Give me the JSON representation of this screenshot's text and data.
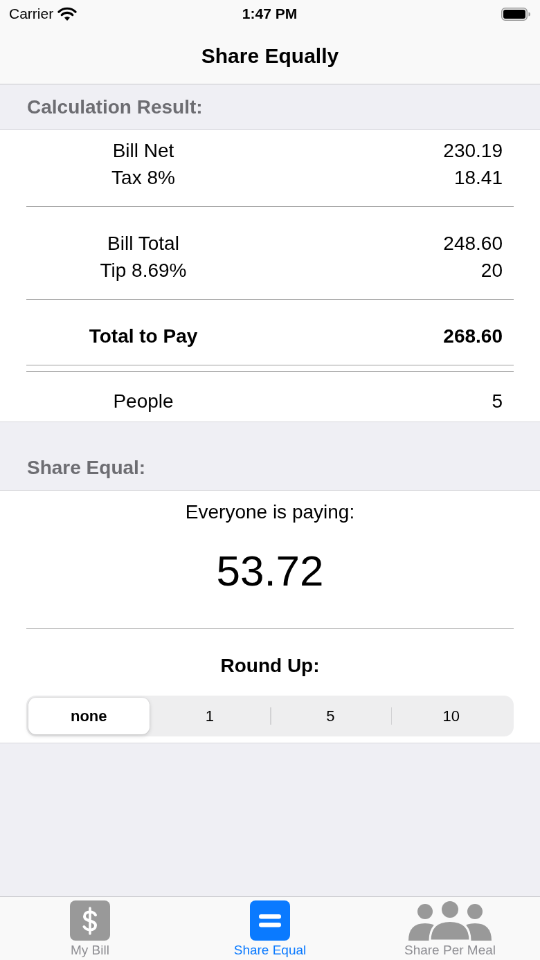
{
  "status_bar": {
    "carrier": "Carrier",
    "time": "1:47 PM"
  },
  "nav_bar": {
    "title": "Share Equally"
  },
  "calculation": {
    "header": "Calculation Result:",
    "lines": [
      {
        "kind": "row",
        "label": "Bill Net",
        "value": "230.19",
        "bold": false
      },
      {
        "kind": "row",
        "label": "Tax 8%",
        "value": "18.41",
        "bold": false
      },
      {
        "kind": "rule"
      },
      {
        "kind": "row",
        "label": "Bill Total",
        "value": "248.60",
        "bold": false
      },
      {
        "kind": "row",
        "label": "Tip 8.69%",
        "value": "20",
        "bold": false
      },
      {
        "kind": "rule"
      },
      {
        "kind": "row",
        "label": "Total to Pay",
        "value": "268.60",
        "bold": true
      },
      {
        "kind": "double"
      },
      {
        "kind": "row",
        "label": "People",
        "value": "5",
        "bold": false
      }
    ]
  },
  "share": {
    "header": "Share Equal:",
    "caption": "Everyone is paying:",
    "amount": "53.72",
    "round_up": {
      "label": "Round Up:",
      "options": [
        {
          "label": "none",
          "selected": true
        },
        {
          "label": "1",
          "selected": false
        },
        {
          "label": "5",
          "selected": false
        },
        {
          "label": "10",
          "selected": false
        }
      ]
    }
  },
  "tab_bar": {
    "items": [
      {
        "label": "My Bill",
        "selected": false
      },
      {
        "label": "Share Equal",
        "selected": true
      },
      {
        "label": "Share Per Meal",
        "selected": false
      }
    ]
  }
}
